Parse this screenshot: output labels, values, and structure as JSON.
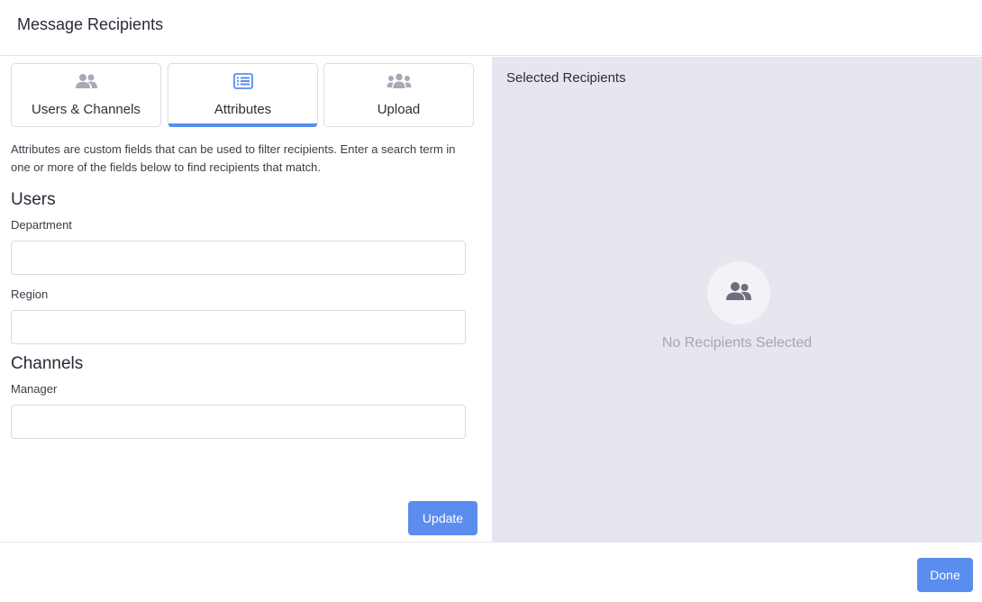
{
  "dialog": {
    "title": "Message Recipients"
  },
  "tabs": [
    {
      "label": "Users & Channels",
      "icon": "users-icon",
      "active": false
    },
    {
      "label": "Attributes",
      "icon": "list-icon",
      "active": true
    },
    {
      "label": "Upload",
      "icon": "group-upload-icon",
      "active": false
    }
  ],
  "attributes": {
    "description": "Attributes are custom fields that can be used to filter recipients. Enter a search term in one or more of the fields below to find recipients that match.",
    "users_section": "Users",
    "channels_section": "Channels",
    "fields": {
      "department": {
        "label": "Department",
        "value": ""
      },
      "region": {
        "label": "Region",
        "value": ""
      },
      "manager": {
        "label": "Manager",
        "value": ""
      }
    },
    "update_label": "Update"
  },
  "recipients": {
    "title": "Selected Recipients",
    "empty_text": "No Recipients Selected",
    "empty_icon": "users-icon"
  },
  "footer": {
    "done_label": "Done"
  },
  "colors": {
    "accent": "#5b8def",
    "panel_bg": "#e6e6ef",
    "muted_text": "#a6a6b3"
  }
}
